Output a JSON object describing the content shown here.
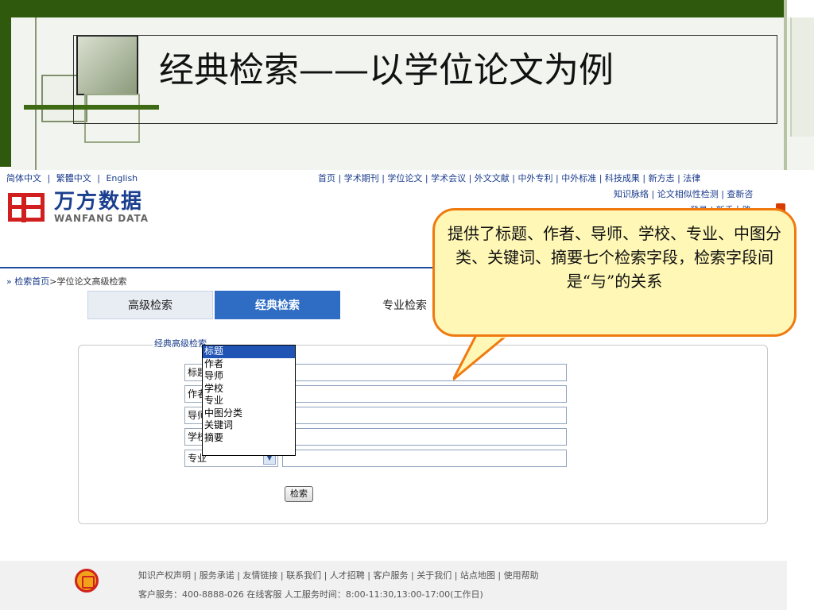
{
  "slide": {
    "title": "经典检索——以学位论文为例"
  },
  "site": {
    "lang": [
      "简体中文",
      "|",
      "繁體中文",
      "|",
      "English"
    ],
    "logo_cn": "万方数据",
    "logo_en": "WANFANG DATA",
    "topnav": "首页 | 学术期刊 | 学位论文 | 学术会议 | 外文文献 | 中外专利 | 中外标准 | 科技成果 | 新方志 | 法律",
    "topnav_home": "首页",
    "subnav": "知识脉络 | 论文相似性检测 | 查新咨",
    "login_line": "登录 | 新手上路",
    "breadcrumb_link": "检索首页",
    "breadcrumb_current": ">学位论文高级检索",
    "breadcrumb_prefix": "»"
  },
  "tabs": [
    {
      "label": "高级检索"
    },
    {
      "label": "经典检索"
    },
    {
      "label": "专业检索"
    }
  ],
  "form": {
    "legend": "经典高级检索",
    "rows": [
      {
        "field": "标题"
      },
      {
        "field": "作者"
      },
      {
        "field": "导师"
      },
      {
        "field": "学校"
      },
      {
        "field": "专业"
      }
    ],
    "dropdown_options": [
      "标题",
      "作者",
      "导师",
      "学校",
      "专业",
      "中图分类",
      "关键词",
      "摘要"
    ],
    "dropdown_selected": "标题",
    "search_button": "检索"
  },
  "footer": {
    "links": "知识产权声明 | 服务承诺 | 友情链接 | 联系我们 | 人才招聘 | 客户服务 | 关于我们 | 站点地图 | 使用帮助",
    "service": "客户服务：400-8888-026 在线客服  人工服务时间：8:00-11:30,13:00-17:00(工作日)"
  },
  "callout": {
    "text": "提供了标题、作者、导师、学校、专业、中图分类、关键词、摘要七个检索字段，检索字段间是“与”的关系"
  },
  "colors": {
    "frame_green": "#2f5a0e",
    "accent_blue": "#2f6dc4",
    "callout_fill": "#fff7b5",
    "callout_border": "#f07a10"
  }
}
